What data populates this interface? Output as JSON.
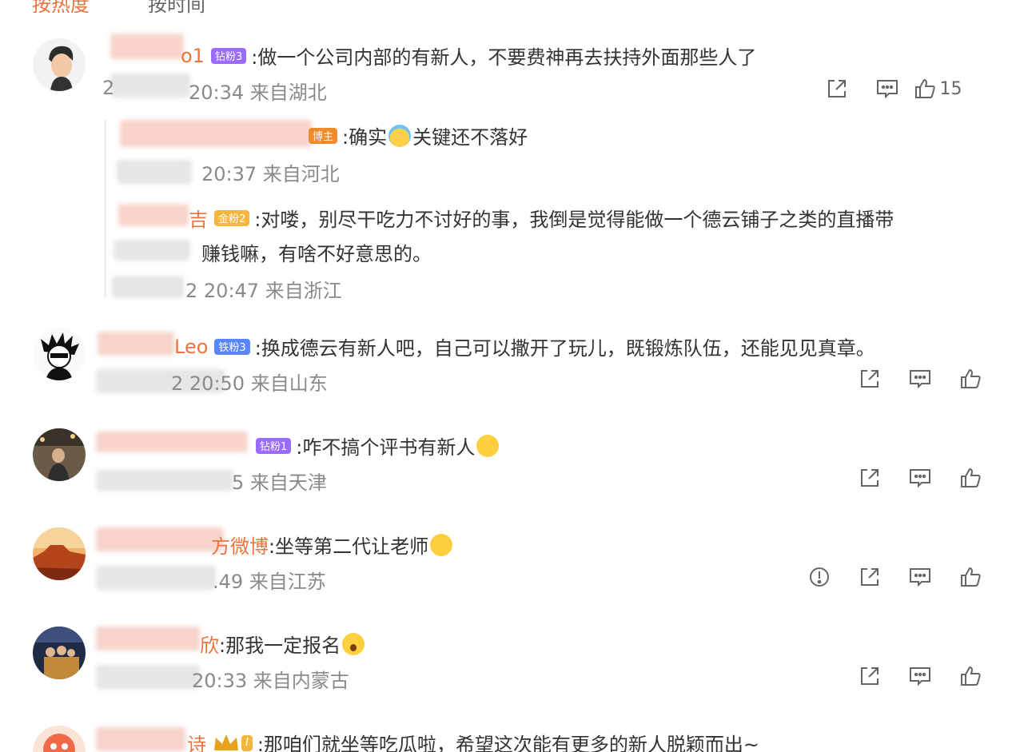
{
  "tabs": {
    "hot": "按热度",
    "time": "按时间"
  },
  "comments": [
    {
      "name_visible": "o1",
      "badge": "钻粉3",
      "text": ":做一个公司内部的有新人，不要费神再去扶持外面那些人了",
      "meta_prefix": "2",
      "meta": "20:34 来自湖北",
      "likes": "15"
    },
    {
      "badge": "博主",
      "text": ":确实",
      "text2": "关键还不落好",
      "meta": "20:37 来自河北"
    },
    {
      "name_visible": "吉",
      "badge": "金粉2",
      "text": ":对喽，别尽干吃力不讨好的事，我倒是觉得能做一个德云铺子之类的直播带",
      "text_line2": "赚钱嘛，有啥不好意思的。",
      "meta": "2 20:47 来自浙江"
    },
    {
      "name_visible": "Leo",
      "badge": "铁粉3",
      "text": ":换成德云有新人吧，自己可以撒开了玩儿，既锻炼队伍，还能见见真章。",
      "meta": "2 20:50 来自山东"
    },
    {
      "badge": "钻粉1",
      "text": ":咋不搞个评书有新人",
      "meta": "5 来自天津"
    },
    {
      "name_visible": "方微博",
      "text": ":坐等第二代让老师",
      "meta": ".49 来自江苏"
    },
    {
      "name_visible": "欣",
      "text": ":那我一定报名",
      "meta": "20:33 来自内蒙古"
    },
    {
      "name_visible": "诗",
      "badge": "I",
      "text": ":那咱们就坐等吃瓜啦，希望这次能有更多的新人脱颖而出~"
    }
  ],
  "icons": [
    "share-icon",
    "comment-icon",
    "like-icon",
    "report-icon"
  ]
}
